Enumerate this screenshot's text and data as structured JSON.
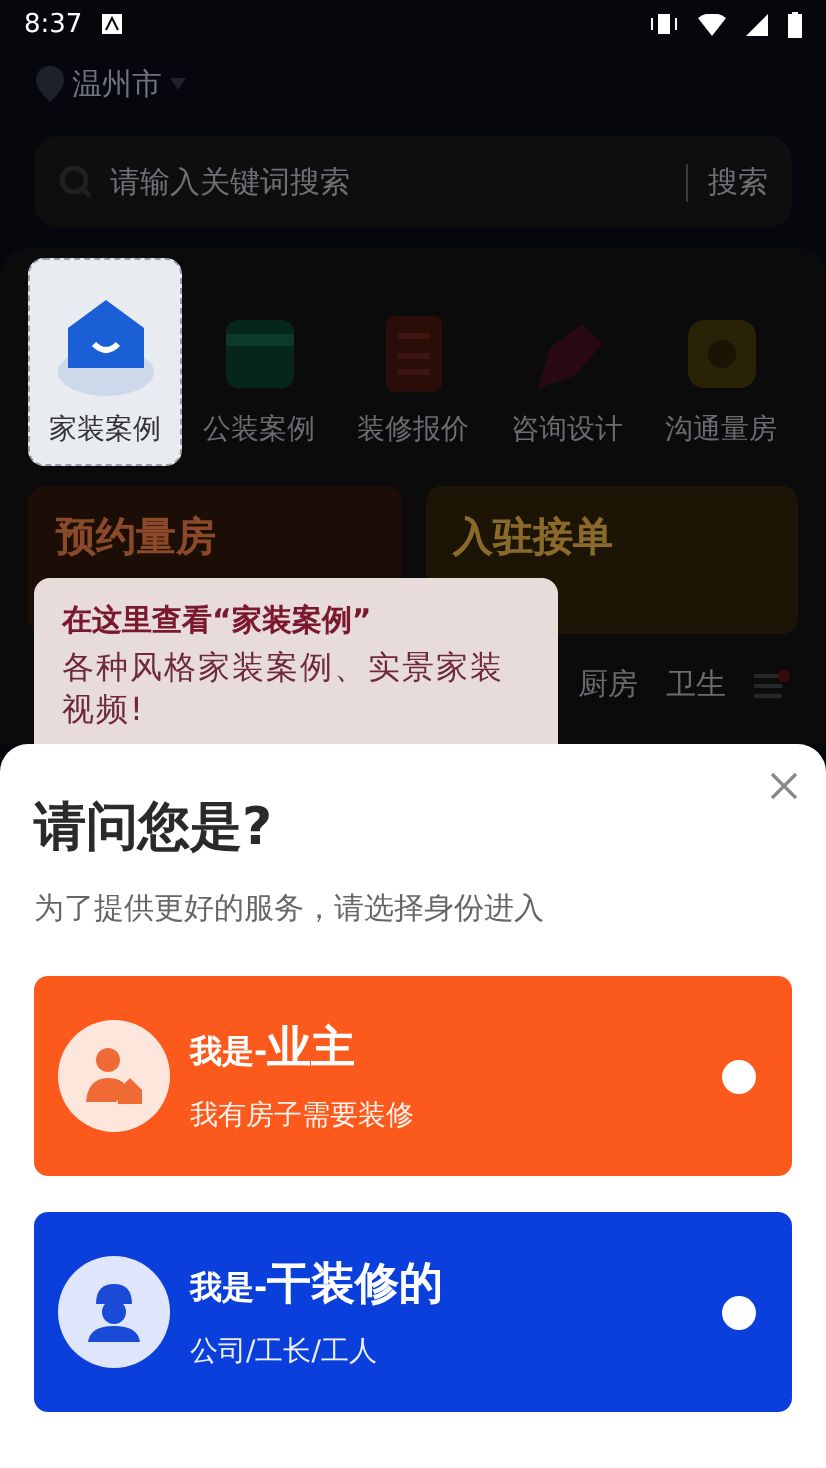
{
  "status_bar": {
    "time": "8:37"
  },
  "location": {
    "city": "温州市"
  },
  "search": {
    "placeholder": "请输入关键词搜索",
    "button": "搜索"
  },
  "categories": [
    {
      "label": "家装案例",
      "kind": "house",
      "selected": true
    },
    {
      "label": "公装案例",
      "kind": "shop",
      "selected": false
    },
    {
      "label": "装修报价",
      "kind": "calculator",
      "selected": false
    },
    {
      "label": "咨询设计",
      "kind": "pen",
      "selected": false
    },
    {
      "label": "沟通量房",
      "kind": "tape",
      "selected": false
    }
  ],
  "banners": [
    {
      "title": "预约量房",
      "kind": "orange"
    },
    {
      "title": "入驻接单",
      "kind": "yellow"
    }
  ],
  "tabs": [
    {
      "label": "厨房"
    },
    {
      "label": "卫生"
    }
  ],
  "tooltip": {
    "title": "在这里查看“家装案例”",
    "body": "各种风格家装案例、实景家装视频!"
  },
  "dialog": {
    "title": "请问您是?",
    "subtitle": "为了提供更好的服务，请选择身份进入",
    "options": [
      {
        "prefix": "我是-",
        "role": "业主",
        "description": "我有房子需要装修",
        "kind": "owner",
        "color": "#fc5a1c",
        "selected": false
      },
      {
        "prefix": "我是-",
        "role": "干装修的",
        "description": "公司/工长/工人",
        "kind": "worker",
        "color": "#0a3fdc",
        "selected": false
      }
    ]
  }
}
